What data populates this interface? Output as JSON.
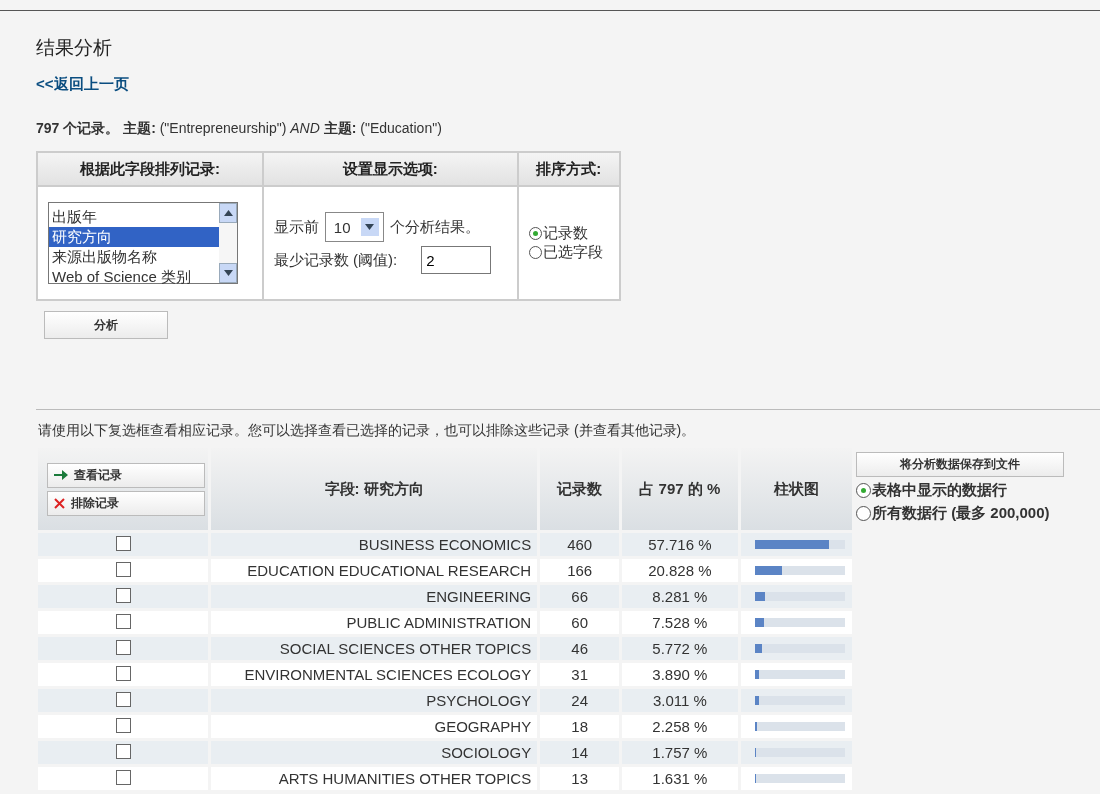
{
  "page": {
    "title": "结果分析",
    "back_link": "<<返回上一页"
  },
  "query": {
    "summary": "**797 个记录。 主题:** (\"Entrepreneurship\") *AND* **主题:** (\"Education\")"
  },
  "options_table": {
    "columns": [
      "根据此字段排列记录:",
      "设置显示选项:",
      "排序方式:"
    ],
    "field_list": [
      {
        "label": "出版年",
        "selected": false
      },
      {
        "label": "研究方向",
        "selected": true
      },
      {
        "label": "来源出版物名称",
        "selected": false
      },
      {
        "label": "Web of Science 类别",
        "selected": false
      }
    ],
    "show_top_label": "显示前",
    "show_top_value": "10",
    "show_top_suffix": "个分析结果。",
    "min_records_label": "最少记录数 (阈值):",
    "min_records_value": "2",
    "sort_options": [
      {
        "label": "记录数",
        "selected": true
      },
      {
        "label": "已选字段",
        "selected": false
      }
    ]
  },
  "analyze_button": "分析",
  "instructions": "请使用以下复选框查看相应记录。您可以选择查看已选择的记录，也可以排除这些记录 (并查看其他记录)。",
  "results_table": {
    "view_button": "查看记录",
    "exclude_button": "排除记录",
    "columns": [
      "字段: 研究方向",
      "记录数",
      "占 797 的 %",
      "柱状图"
    ],
    "rows": [
      {
        "checked": false,
        "field": "BUSINESS ECONOMICS",
        "count": "460",
        "percent": "57.716 %",
        "level": 0.83
      },
      {
        "checked": false,
        "field": "EDUCATION EDUCATIONAL RESEARCH",
        "count": "166",
        "percent": "20.828 %",
        "level": 0.3
      },
      {
        "checked": false,
        "field": "ENGINEERING",
        "count": "66",
        "percent": "8.281 %",
        "level": 0.12
      },
      {
        "checked": false,
        "field": "PUBLIC ADMINISTRATION",
        "count": "60",
        "percent": "7.528 %",
        "level": 0.11
      },
      {
        "checked": false,
        "field": "SOCIAL SCIENCES OTHER TOPICS",
        "count": "46",
        "percent": "5.772 %",
        "level": 0.08
      },
      {
        "checked": false,
        "field": "ENVIRONMENTAL SCIENCES ECOLOGY",
        "count": "31",
        "percent": "3.890 %",
        "level": 0.05
      },
      {
        "checked": false,
        "field": "PSYCHOLOGY",
        "count": "24",
        "percent": "3.011 %",
        "level": 0.05
      },
      {
        "checked": false,
        "field": "GEOGRAPHY",
        "count": "18",
        "percent": "2.258 %",
        "level": 0.03
      },
      {
        "checked": false,
        "field": "SOCIOLOGY",
        "count": "14",
        "percent": "1.757 %",
        "level": 0.02
      },
      {
        "checked": false,
        "field": "ARTS HUMANITIES OTHER TOPICS",
        "count": "13",
        "percent": "1.631 %",
        "level": 0.02
      }
    ]
  },
  "save_panel": {
    "button": "将分析数据保存到文件",
    "options": [
      {
        "label": "表格中显示的数据行",
        "selected": true
      },
      {
        "label": "所有数据行 (最多 200,000)",
        "selected": false
      }
    ]
  }
}
